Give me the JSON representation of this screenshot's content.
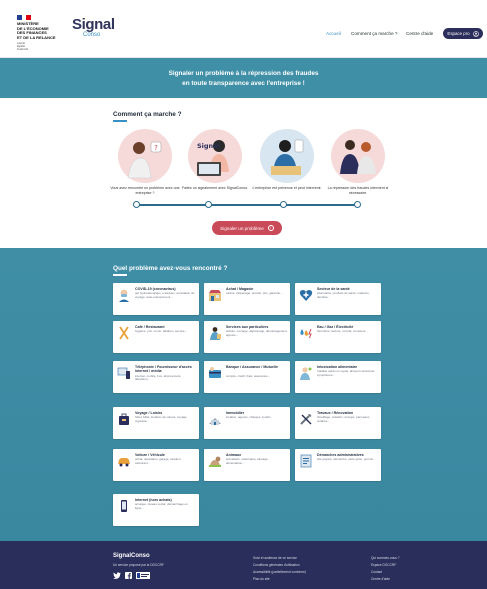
{
  "header": {
    "ministry": [
      "MINISTÈRE",
      "DE L'ÉCONOMIE",
      "DES FINANCES",
      "ET DE LA RELANCE"
    ],
    "motto": [
      "Liberté",
      "Égalité",
      "Fraternité"
    ],
    "logo_main": "Signal",
    "logo_sub": "Conso",
    "nav": [
      {
        "label": "Accueil",
        "active": true
      },
      {
        "label": "Comment ça marche ?",
        "active": false
      },
      {
        "label": "Centre d'aide",
        "active": false
      }
    ],
    "pro_button": "Espace pro"
  },
  "hero": {
    "line1": "Signaler un problème à la répression des fraudes",
    "line2": "en toute transparence avec l'entreprise !"
  },
  "how": {
    "title": "Comment ça marche ?",
    "steps": [
      "Vous avez rencontré un problème avec une entreprise ?",
      "Faites un signalement avec SignalConso.",
      "L'entreprise est prévenue et peut intervenir.",
      "La répression des fraudes intervient si nécessaire."
    ],
    "cta": "Signaler un problème"
  },
  "problems": {
    "title": "Quel problème avez-vous rencontré ?",
    "items": [
      {
        "title": "COVID-19 (coronavirus)",
        "desc": "gel hydroalcoolique, masques, annulation de voyage, auto-entrepreneur..."
      },
      {
        "title": "Achat / Magasin",
        "desc": "caisse, étiquetage, produit, prix, garantie..."
      },
      {
        "title": "Secteur de la santé",
        "desc": "pharmacie, produits de santé, médecin, dentiste..."
      },
      {
        "title": "Café / Restaurant",
        "desc": "hygiène, prix, menu, addition, service..."
      },
      {
        "title": "Services aux particuliers",
        "desc": "artisan, ménage, dépannage, déménagement, agence..."
      },
      {
        "title": "Eau / Gaz / Électricité",
        "desc": "fourniture, facture, contrat, compteur..."
      },
      {
        "title": "Téléphonie / Fournisseur d'accès internet / média",
        "desc": "internet, mobile, box, abonnement, télévision..."
      },
      {
        "title": "Banque / Assurance / Mutuelle",
        "desc": "compte, crédit, frais, assurance..."
      },
      {
        "title": "Intoxication alimentaire",
        "desc": "malaise après un repas, aliment contaminé, symptômes..."
      },
      {
        "title": "Voyage / Loisirs",
        "desc": "hôtel, billet, location de voiture, voyage organisé..."
      },
      {
        "title": "Immobilier",
        "desc": "location, agence, charges, syndic..."
      },
      {
        "title": "Travaux / Rénovation",
        "desc": "chauffage, isolation, énergie, panneaux solaires..."
      },
      {
        "title": "Voiture / Véhicule",
        "desc": "achat, réparation, garage, location, carburant..."
      },
      {
        "title": "Animaux",
        "desc": "animalerie, vétérinaire, élevage, alimentation..."
      },
      {
        "title": "Démarches administratives",
        "desc": "site payant, démarche, carte grise, permis..."
      },
      {
        "title": "Internet (hors achats)",
        "desc": "arnaque, réseau social, démarchage en ligne..."
      }
    ]
  },
  "footer": {
    "brand": "SignalConso",
    "subtitle": "Un service proposé par la DGCCRF",
    "col1": [
      "Suivi et audience de ce service",
      "Conditions générales d'utilisation",
      "Accessibilité (partiellement conforme)",
      "Plan du site"
    ],
    "col2": [
      "Qui sommes-nous ?",
      "Espace DGCCRF",
      "Contact",
      "Centre d'aide"
    ]
  },
  "colors": {
    "navy": "#2b2e5a",
    "teal": "#3f8fa6",
    "accent_blue": "#3a8fc4",
    "cta_red": "#c94b5a"
  }
}
